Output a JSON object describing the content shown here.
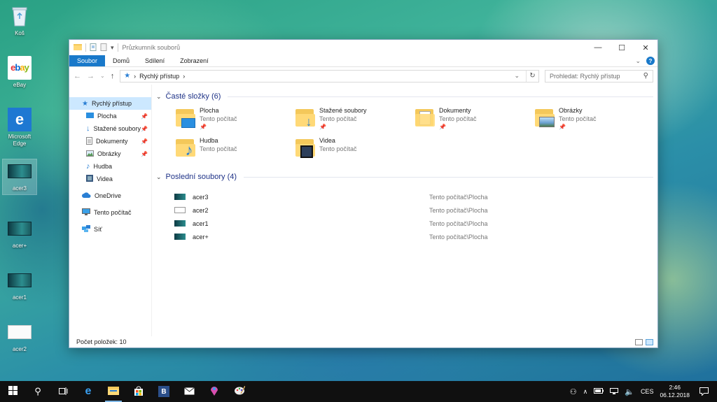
{
  "desktop": {
    "icons": [
      {
        "label": "Koš",
        "icon": "recycle-bin-icon"
      },
      {
        "label": "eBay",
        "icon": "ebay-icon"
      },
      {
        "label": "Microsoft Edge",
        "icon": "edge-icon"
      },
      {
        "label": "acer3",
        "icon": "image-thumbnail"
      },
      {
        "label": "acer+",
        "icon": "image-thumbnail"
      },
      {
        "label": "acer1",
        "icon": "image-thumbnail"
      },
      {
        "label": "acer2",
        "icon": "image-thumbnail"
      }
    ]
  },
  "window": {
    "title": "Průzkumník souborů",
    "ribbon_tabs": [
      "Soubor",
      "Domů",
      "Sdílení",
      "Zobrazení"
    ],
    "address": {
      "location": "Rychlý přístup"
    },
    "search_placeholder": "Prohledat: Rychlý přístup",
    "nav_pane": {
      "quick_access": "Rychlý přístup",
      "pinned": [
        "Plocha",
        "Stažené soubory",
        "Dokumenty",
        "Obrázky"
      ],
      "unpinned": [
        "Hudba",
        "Videa"
      ],
      "onedrive": "OneDrive",
      "this_pc": "Tento počítač",
      "network": "Síť"
    },
    "frequent": {
      "header": "Časté složky (6)",
      "folders": [
        {
          "name": "Plocha",
          "location": "Tento počítač",
          "pinned": true,
          "icon": "desktop-folder-icon"
        },
        {
          "name": "Stažené soubory",
          "location": "Tento počítač",
          "pinned": true,
          "icon": "downloads-folder-icon"
        },
        {
          "name": "Dokumenty",
          "location": "Tento počítač",
          "pinned": true,
          "icon": "documents-folder-icon"
        },
        {
          "name": "Obrázky",
          "location": "Tento počítač",
          "pinned": true,
          "icon": "pictures-folder-icon"
        },
        {
          "name": "Hudba",
          "location": "Tento počítač",
          "pinned": false,
          "icon": "music-folder-icon"
        },
        {
          "name": "Videa",
          "location": "Tento počítač",
          "pinned": false,
          "icon": "videos-folder-icon"
        }
      ]
    },
    "recent": {
      "header": "Poslední soubory (4)",
      "files": [
        {
          "name": "acer3",
          "path": "Tento počítač\\Plocha"
        },
        {
          "name": "acer2",
          "path": "Tento počítač\\Plocha"
        },
        {
          "name": "acer1",
          "path": "Tento počítač\\Plocha"
        },
        {
          "name": "acer+",
          "path": "Tento počítač\\Plocha"
        }
      ]
    },
    "status": "Počet položek: 10"
  },
  "taskbar": {
    "language": "CES",
    "time": "2:46",
    "date": "06.12.2018"
  },
  "colors": {
    "accent": "#1979ca",
    "selection": "#cce8ff",
    "group_header": "#1e3287"
  }
}
